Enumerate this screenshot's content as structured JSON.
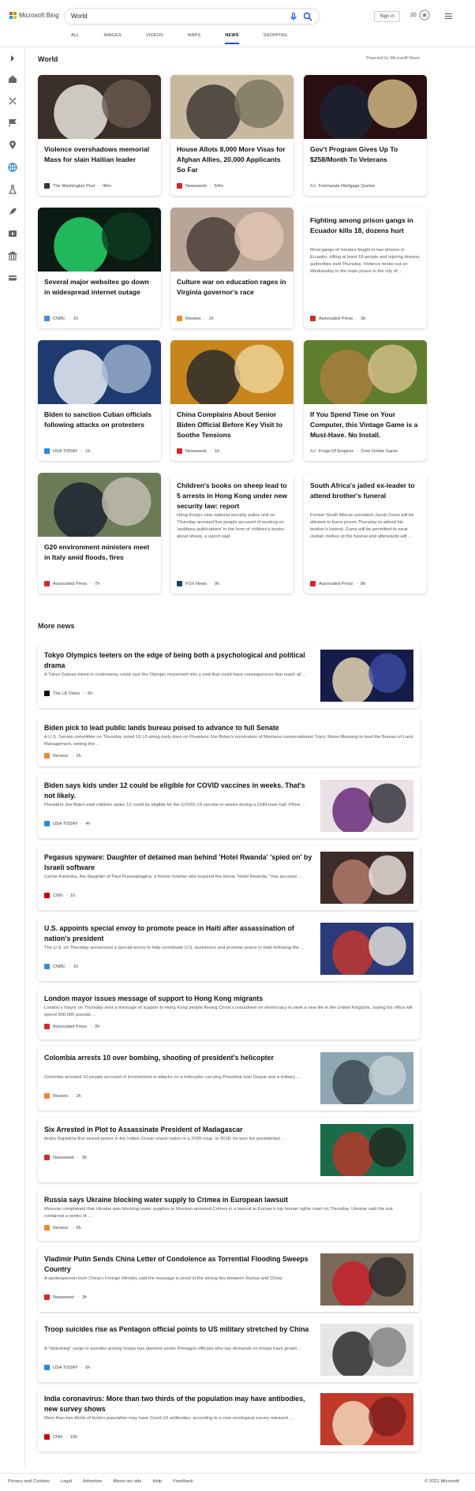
{
  "header": {
    "logo_text": "Microsoft Bing",
    "search_value": "World",
    "signin_label": "Sign in",
    "points": "20",
    "scopes": [
      {
        "label": "ALL",
        "active": false
      },
      {
        "label": "IMAGES",
        "active": false
      },
      {
        "label": "VIDEOS",
        "active": false
      },
      {
        "label": "MAPS",
        "active": false
      },
      {
        "label": "NEWS",
        "active": true
      },
      {
        "label": "SHOPPING",
        "active": false
      }
    ]
  },
  "sidebar": {
    "icons": [
      "expand-icon",
      "home-icon",
      "topics-icon",
      "flag-icon",
      "location-icon",
      "globe-icon",
      "science-icon",
      "rocket-icon",
      "entertainment-icon",
      "business-icon",
      "money-icon"
    ]
  },
  "world": {
    "title": "World",
    "powered_by": "Powered by Microsoft News",
    "cards": [
      {
        "title": "Violence overshadows memorial Mass for slain Haitian leader",
        "source": "The Washington Post",
        "time": "46m",
        "src_color": "#333333",
        "image": "haiti-crowd"
      },
      {
        "title": "House Allots 8,000 More Visas for Afghan Allies, 20,000 Applicants So Far",
        "source": "Newsweek",
        "time": "54m",
        "src_color": "#d62828",
        "image": "afghan-men"
      },
      {
        "title": "Gov't Program Gives Up To $258/Month To Veterans",
        "source": "Fetcharate Mortgage Quotes",
        "time": "",
        "ad": "Ad",
        "src_color": "#999999",
        "image": "navy-officer"
      },
      {
        "title": "Several major websites go down in widespread internet outage",
        "source": "CNBC",
        "time": "1h",
        "src_color": "#3c8dde",
        "image": "server-room"
      },
      {
        "title": "Culture war on education rages in Virginia governor's race",
        "source": "Reuters",
        "time": "1h",
        "src_color": "#f08a24",
        "image": "school-meeting"
      },
      {
        "title": "Fighting among prison gangs in Ecuador kills 18, dozens hurt",
        "snippet": "Rival gangs of inmates fought in two prisons in Ecuador, killing at least 18 people and injuring dozens, authorities said Thursday. Violence broke out on Wednesday in the main prison in the city of ...",
        "source": "Associated Press",
        "time": "3h",
        "src_color": "#d62828",
        "image": ""
      },
      {
        "title": "Biden to sanction Cuban officials following attacks on protesters",
        "source": "USA TODAY",
        "time": "1h",
        "src_color": "#1a8fe3",
        "image": "biden-podium"
      },
      {
        "title": "China Complains About Senior Biden Official Before Key Visit to Soothe Tensions",
        "source": "Newsweek",
        "time": "1h",
        "src_color": "#d62828",
        "image": "officials-flags"
      },
      {
        "title": "If You Spend Time on Your Computer, this Vintage Game is a Must-Have. No Install.",
        "source": "Forge Of Empires",
        "time": "Free Online Game",
        "ad": "Ad",
        "src_color": "#999999",
        "image": "game-village"
      },
      {
        "title": "G20 environment ministers meet in Italy amid floods, fires",
        "source": "Associated Press",
        "time": "7h",
        "src_color": "#d62828",
        "image": "g20-ministers"
      },
      {
        "title": "Children's books on sheep lead to 5 arrests in Hong Kong under new security law: report",
        "snippet": "Hong Kong's new national security police unit on Thursday arrested five people accused of working on 'seditious publications' in the form of children's books about sheep, a report said.",
        "source": "FOX News",
        "time": "9h",
        "src_color": "#1f3b73",
        "image": ""
      },
      {
        "title": "South Africa's jailed ex-leader to attend brother's funeral",
        "snippet": "Former South African president Jacob Zuma will be allowed to leave prison Thursday to attend his brother's funeral. Zuma will be permitted to wear civilian clothes at the funeral and afterwards will ...",
        "source": "Associated Press",
        "time": "8h",
        "src_color": "#d62828",
        "image": ""
      }
    ]
  },
  "more_news": {
    "title": "More news",
    "items": [
      {
        "title": "Tokyo Olympics teeters on the edge of being both a psychological and political drama",
        "snippet": "A Tokyo Games mired in controversy could cast the Olympic movement into a void that could have consequences that reach all ...",
        "source": "The LA Times",
        "time": "6h",
        "src_color": "#111111",
        "image": "olympics-statue"
      },
      {
        "title": "Biden pick to lead public lands bureau poised to advance to full Senate",
        "snippet": "A U.S. Senate committee on Thursday voted 10-10 along party lines on President Joe Biden's nomination of Montana conservationist Tracy Stone-Manning to lead the Bureau of Land Management, setting the ...",
        "source": "Reuters",
        "time": "2h",
        "src_color": "#f08a24",
        "image": ""
      },
      {
        "title": "Biden says kids under 12 could be eligible for COVID vaccines in weeks. That's not likely.",
        "snippet": "President Joe Biden said children under 12 could be eligible for the COVID-19 vaccine in weeks during a CNN town hall. Pfizer ...",
        "source": "USA TODAY",
        "time": "4h",
        "src_color": "#1a8fe3",
        "image": "vaccine-kids"
      },
      {
        "title": "Pegasus spyware: Daughter of detained man behind 'Hotel Rwanda' 'spied on' by Israeli software",
        "snippet": "Carine Kanimba, the daughter of Paul Rusesabagina, a former hotelier who inspired the movie \"Hotel Rwanda,\" has accused ...",
        "source": "CNN",
        "time": "1h",
        "src_color": "#cc0000",
        "image": "rwanda-daughter"
      },
      {
        "title": "U.S. appoints special envoy to promote peace in Haiti after assassination of nation's president",
        "snippet": "The U.S. on Thursday announced a special envoy to help coordinate U.S. assistance and promote peace in Haiti following the ...",
        "source": "CNBC",
        "time": "1h",
        "src_color": "#3c8dde",
        "image": "haiti-portrait"
      },
      {
        "title": "London mayor issues message of support to Hong Kong migrants",
        "snippet": "London's mayor on Thursday sent a message of support to Hong Kong people fleeing China's crackdown on democracy to seek a new life in the United Kingdom, saying his office will spend 900,000 pounds ...",
        "source": "Associated Press",
        "time": "2h",
        "src_color": "#d62828",
        "image": ""
      },
      {
        "title": "Colombia arrests 10 over bombing, shooting of president's helicopter",
        "snippet": "Colombia arrested 10 people accused of involvement in attacks on a helicopter carrying President Ivan Duque and a military ...",
        "source": "Reuters",
        "time": "2h",
        "src_color": "#f08a24",
        "image": "helicopter-damage"
      },
      {
        "title": "Six Arrested in Plot to Assassinate President of Madagascar",
        "snippet": "Andry Rajoelina first seized power in the Indian Ocean island nation in a 2009 coup. In 2018, he won the presidential ...",
        "source": "Newsweek",
        "time": "3h",
        "src_color": "#d62828",
        "image": "madagascar-president"
      },
      {
        "title": "Russia says Ukraine blocking water supply to Crimea in European lawsuit",
        "snippet": "Moscow complained that Ukraine was blocking water supplies to Russian-annexed Crimea in a lawsuit at Europe's top human rights court on Thursday. Ukraine said the suit contained a series of ...",
        "source": "Reuters",
        "time": "5h",
        "src_color": "#f08a24",
        "image": ""
      },
      {
        "title": "Vladimir Putin Sends China Letter of Condolence as Torrential Flooding Sweeps Country",
        "snippet": "A spokesperson from China's Foreign Ministry said the message is proof of the strong ties between Russia and China.",
        "source": "Newsweek",
        "time": "3h",
        "src_color": "#d62828",
        "image": "putin-xi"
      },
      {
        "title": "Troop suicides rise as Pentagon official points to US military stretched by China",
        "snippet": "A \"disturbing\" surge in suicides among troops has alarmed senior Pentagon officials who say demands on troops have grown ...",
        "source": "USA TODAY",
        "time": "6h",
        "src_color": "#1a8fe3",
        "image": "soldier-helicopter"
      },
      {
        "title": "India coronavirus: More than two thirds of the population may have antibodies, new survey shows",
        "snippet": "More than two thirds of India's population may have Covid-19 antibodies, according to a new serological survey released ...",
        "source": "CNN",
        "time": "10h",
        "src_color": "#cc0000",
        "image": "india-swab"
      }
    ]
  },
  "footer": {
    "links": [
      "Privacy and Cookies",
      "Legal",
      "Advertise",
      "About our ads",
      "Help",
      "Feedback"
    ],
    "copyright": "© 2021 Microsoft"
  }
}
